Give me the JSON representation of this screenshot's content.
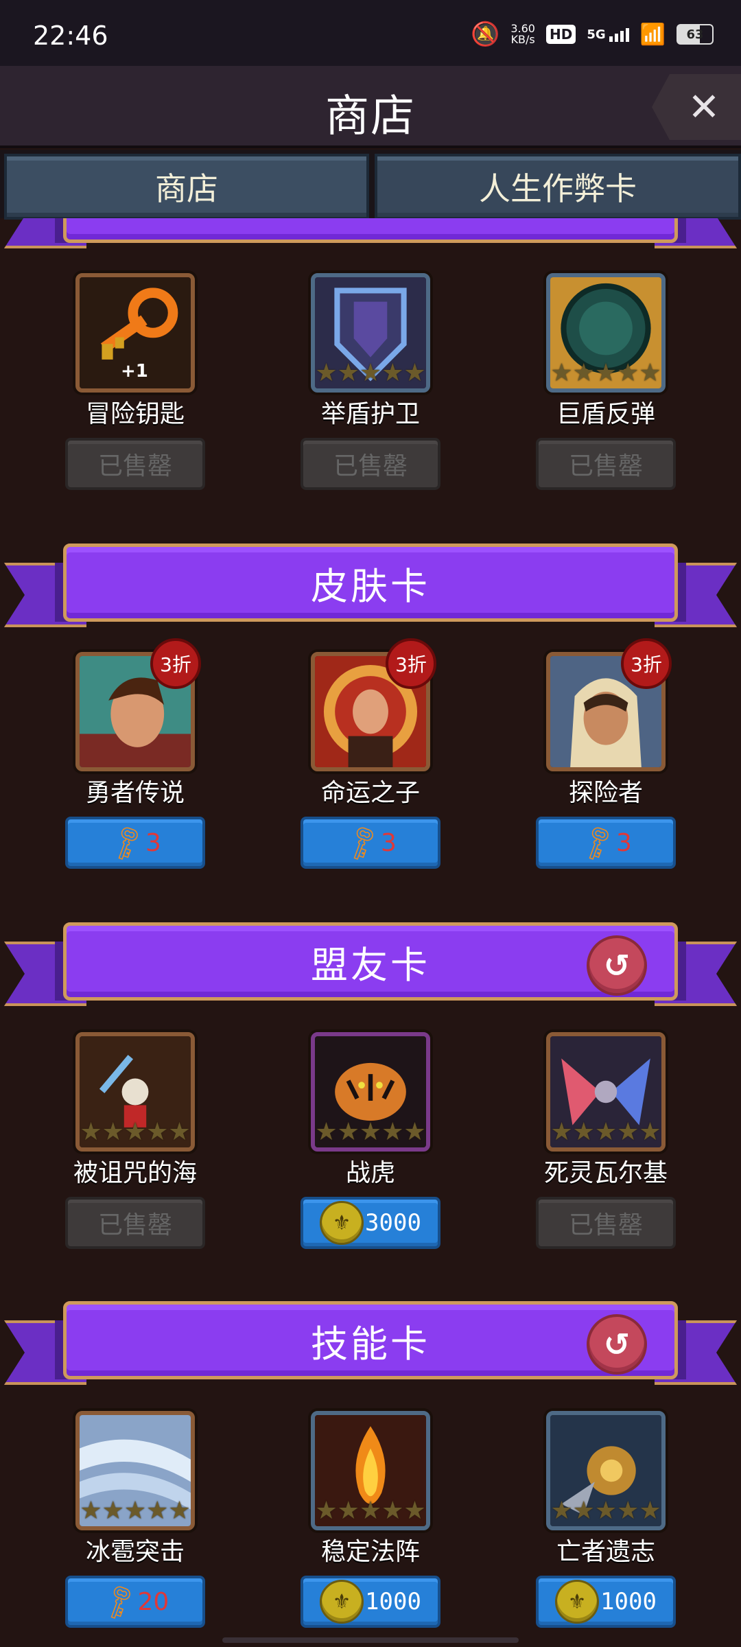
{
  "status": {
    "time": "22:46",
    "net_speed": "3.60",
    "net_unit": "KB/s",
    "hd": "HD",
    "signal": "5G",
    "battery": "63"
  },
  "header": {
    "title": "商店"
  },
  "tabs": [
    {
      "label": "商店"
    },
    {
      "label": "人生作弊卡"
    }
  ],
  "sections": {
    "top": {
      "items": [
        {
          "name": "冒险钥匙",
          "extra": "+1",
          "button": "已售罄"
        },
        {
          "name": "举盾护卫",
          "button": "已售罄"
        },
        {
          "name": "巨盾反弹",
          "button": "已售罄"
        }
      ]
    },
    "skin": {
      "title": "皮肤卡",
      "items": [
        {
          "name": "勇者传说",
          "badge": "3折",
          "price": "3"
        },
        {
          "name": "命运之子",
          "badge": "3折",
          "price": "3"
        },
        {
          "name": "探险者",
          "badge": "3折",
          "price": "3"
        }
      ]
    },
    "ally": {
      "title": "盟友卡",
      "items": [
        {
          "name": "被诅咒的海",
          "button": "已售罄"
        },
        {
          "name": "战虎",
          "price": "3000"
        },
        {
          "name": "死灵瓦尔基",
          "button": "已售罄"
        }
      ]
    },
    "skill": {
      "title": "技能卡",
      "items": [
        {
          "name": "冰雹突击",
          "price": "20"
        },
        {
          "name": "稳定法阵",
          "price": "1000"
        },
        {
          "name": "亡者遗志",
          "price": "1000"
        }
      ]
    }
  },
  "icons": {
    "close": "close-icon",
    "refresh": "refresh-icon",
    "key": "key-icon",
    "coin": "coin-icon",
    "star": "star-icon"
  },
  "colors": {
    "ribbon": "#8b3df0",
    "buy_button": "#2680d8",
    "sold_button": "#3e3a3a",
    "badge": "#b21a1a",
    "key_price": "#e03838"
  }
}
